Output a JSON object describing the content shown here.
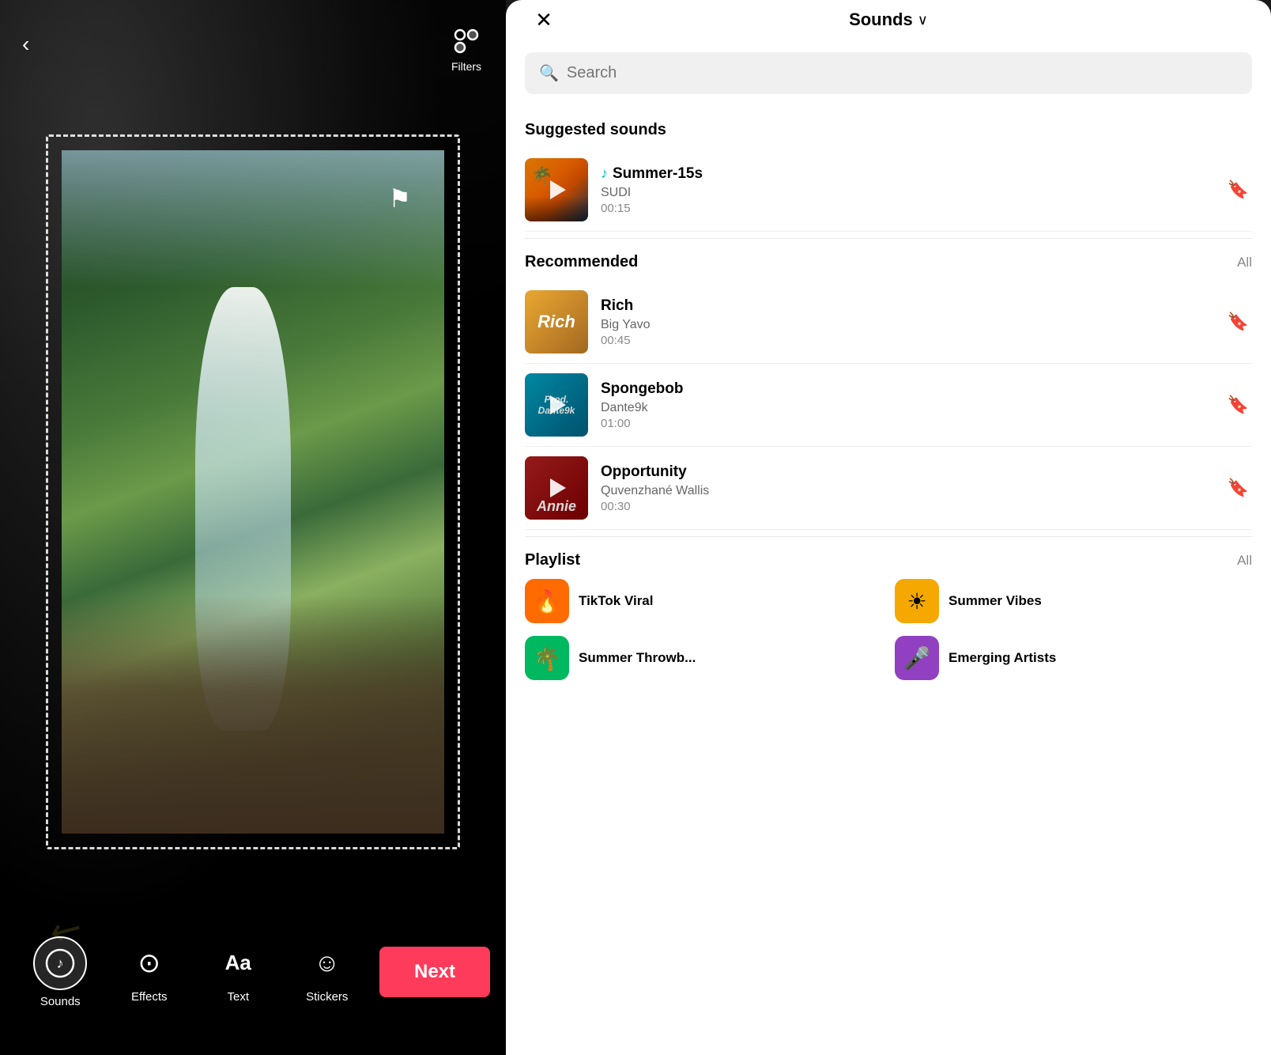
{
  "left": {
    "back_label": "‹",
    "filters_label": "Filters",
    "flag_char": "⚑",
    "arrow_char": "↙",
    "toolbar": {
      "items": [
        {
          "id": "sounds",
          "label": "Sounds",
          "icon": "♫",
          "active": true
        },
        {
          "id": "effects",
          "label": "Effects",
          "icon": "⊙"
        },
        {
          "id": "text",
          "label": "Text",
          "icon": "Aa"
        },
        {
          "id": "stickers",
          "label": "Stickers",
          "icon": "☺"
        }
      ],
      "next_label": "Next"
    }
  },
  "right": {
    "header": {
      "close_icon": "✕",
      "title": "Sounds",
      "chevron": "∨",
      "title_full": "Sounds ∨"
    },
    "search": {
      "placeholder": "Search",
      "icon": "🔍"
    },
    "suggested_section": {
      "title": "Suggested sounds",
      "items": [
        {
          "id": "summer15s",
          "name": "Summer-15s",
          "artist": "SUDI",
          "duration": "00:15",
          "has_note_icon": true,
          "note_color": "#00b8b8"
        }
      ]
    },
    "recommended_section": {
      "title": "Recommended",
      "all_label": "All",
      "items": [
        {
          "id": "rich",
          "name": "Rich",
          "artist": "Big Yavo",
          "duration": "00:45",
          "thumb_label": "Rich"
        },
        {
          "id": "spongebob",
          "name": "Spongebob",
          "artist": "Dante9k",
          "duration": "01:00",
          "thumb_label": "Prod.\nDante9k"
        },
        {
          "id": "opportunity",
          "name": "Opportunity",
          "artist": "Quvenzhané Wallis",
          "duration": "00:30",
          "thumb_label": "Annie"
        }
      ]
    },
    "playlist_section": {
      "title": "Playlist",
      "all_label": "All",
      "items": [
        {
          "id": "tiktok-viral",
          "name": "TikTok Viral",
          "icon_char": "🔥",
          "icon_class": "playlist-icon-viral"
        },
        {
          "id": "summer-vibes",
          "name": "Summer Vibes",
          "icon_char": "☀",
          "icon_class": "playlist-icon-summer"
        },
        {
          "id": "summer-throwb",
          "name": "Summer Throwb...",
          "icon_char": "🌴",
          "icon_class": "playlist-icon-throwb"
        },
        {
          "id": "emerging-artists",
          "name": "Emerging Artists",
          "icon_char": "🎤",
          "icon_class": "playlist-icon-emerging"
        }
      ]
    }
  }
}
